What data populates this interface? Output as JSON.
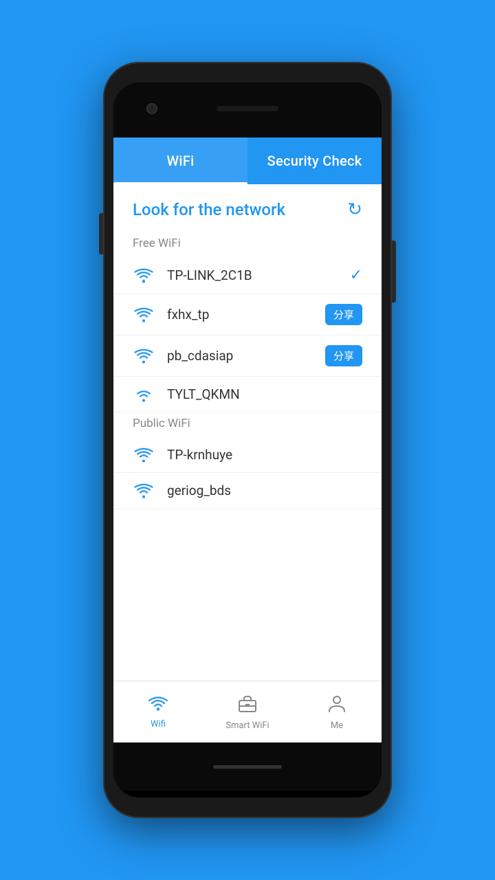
{
  "app": {
    "background_color": "#2196F3"
  },
  "tabs": [
    {
      "id": "wifi",
      "label": "WiFi",
      "active": true
    },
    {
      "id": "security-check",
      "label": "Security Check",
      "active": false
    }
  ],
  "main": {
    "heading": "Look for the network",
    "refresh_icon": "↻",
    "free_wifi_label": "Free WiFi",
    "public_wifi_label": "Public WiFi",
    "free_networks": [
      {
        "name": "TP-LINK_2C1B",
        "action": "check",
        "action_label": ""
      },
      {
        "name": "fxhx_tp",
        "action": "share",
        "action_label": "分享"
      },
      {
        "name": "pb_cdasiap",
        "action": "share",
        "action_label": "分享"
      },
      {
        "name": "TYLT_QKMN",
        "action": "none",
        "action_label": ""
      }
    ],
    "public_networks": [
      {
        "name": "TP-krnhuye",
        "action": "none",
        "action_label": ""
      },
      {
        "name": "geriog_bds",
        "action": "none",
        "action_label": ""
      }
    ]
  },
  "bottom_nav": [
    {
      "id": "wifi",
      "label": "Wifi",
      "active": true,
      "icon": "wifi"
    },
    {
      "id": "smart-wifi",
      "label": "Smart WiFi",
      "active": false,
      "icon": "briefcase"
    },
    {
      "id": "me",
      "label": "Me",
      "active": false,
      "icon": "person"
    }
  ]
}
